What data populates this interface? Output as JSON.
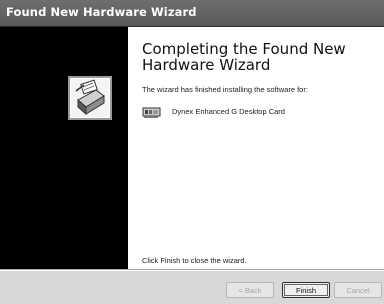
{
  "window": {
    "title": "Found New Hardware Wizard"
  },
  "heading": {
    "line1": "Completing the Found New",
    "line2": "Hardware Wizard"
  },
  "body": {
    "installed_text": "The wizard has finished installing the software for:",
    "device_name": "Dynex Enhanced G Desktop Card",
    "close_text": "Click Finish to close the wizard."
  },
  "buttons": {
    "back": "< Back",
    "finish": "Finish",
    "cancel": "Cancel"
  },
  "icons": {
    "wizard": "hardware-install-icon",
    "device": "network-card-icon"
  }
}
